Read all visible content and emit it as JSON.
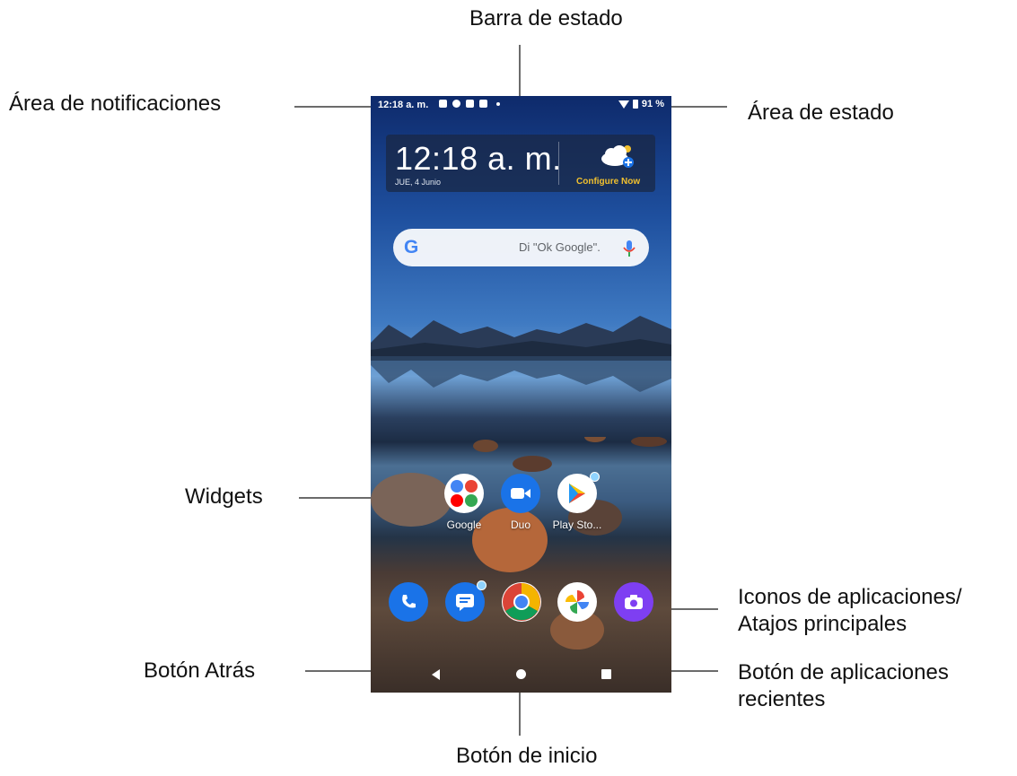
{
  "callouts": {
    "status_bar": "Barra de estado",
    "notifications_area": "Área de notificaciones",
    "status_area": "Área de estado",
    "widgets": "Widgets",
    "app_icons_line1": "Iconos de aplicaciones/",
    "app_icons_line2": "Atajos principales",
    "back_button": "Botón Atrás",
    "recent_apps_line1": "Botón de aplicaciones",
    "recent_apps_line2": "recientes",
    "home_button": "Botón de inicio"
  },
  "phone": {
    "status_bar": {
      "time": "12:18 a. m.",
      "battery": "91 %",
      "icons": [
        "image-icon",
        "gear-icon",
        "news-icon",
        "sd-card-icon",
        "wifi-icon",
        "battery-icon"
      ]
    },
    "clock_widget": {
      "time": "12:18 a. m.",
      "date": "JUE, 4 Junio",
      "weather_action": "Configure Now"
    },
    "search_bar": {
      "logo": "G",
      "placeholder": "Di \"Ok Google\"."
    },
    "apps_row": [
      {
        "label": "Google"
      },
      {
        "label": "Duo"
      },
      {
        "label": "Play Sto..."
      }
    ],
    "dock": [
      {
        "name": "phone-icon",
        "color": "#1a73e8"
      },
      {
        "name": "messages-icon",
        "color": "#1a73e8"
      },
      {
        "name": "chrome-icon",
        "color": "#ffffff"
      },
      {
        "name": "photos-icon",
        "color": "#ffffff"
      },
      {
        "name": "camera-icon",
        "color": "#7e3ff2"
      }
    ]
  }
}
